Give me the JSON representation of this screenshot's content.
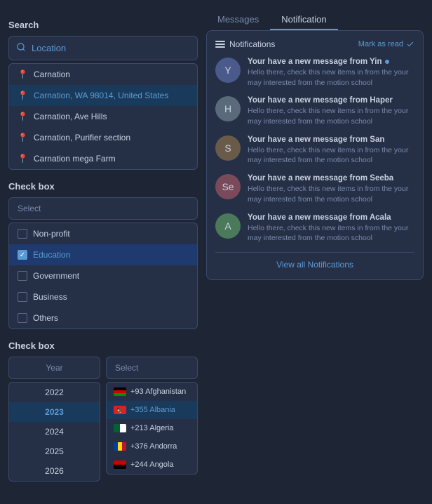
{
  "search": {
    "title": "Search",
    "placeholder": "Location",
    "results": [
      {
        "label": "Carnation",
        "selected": false
      },
      {
        "label": "Carnation, WA 98014, United States",
        "selected": true
      },
      {
        "label": "Carnation, Ave Hills",
        "selected": false
      },
      {
        "label": "Carnation, Purifier section",
        "selected": false
      },
      {
        "label": "Carnation mega Farm",
        "selected": false
      }
    ]
  },
  "checkbox1": {
    "title": "Check box",
    "placeholder": "Select",
    "items": [
      {
        "label": "Non-profit",
        "checked": false
      },
      {
        "label": "Education",
        "checked": true
      },
      {
        "label": "Government",
        "checked": false
      },
      {
        "label": "Business",
        "checked": false
      },
      {
        "label": "Others",
        "checked": false
      }
    ]
  },
  "checkbox2": {
    "title": "Check box",
    "year_placeholder": "Year",
    "country_placeholder": "Select",
    "years": [
      {
        "value": "2022",
        "selected": false
      },
      {
        "value": "2023",
        "selected": true
      },
      {
        "value": "2024",
        "selected": false
      },
      {
        "value": "2025",
        "selected": false
      },
      {
        "value": "2026",
        "selected": false
      }
    ],
    "countries": [
      {
        "code": "AF",
        "dial": "+93",
        "name": "Afghanistan",
        "selected": false,
        "color": "#000000"
      },
      {
        "code": "AL",
        "dial": "+355",
        "name": "Albania",
        "selected": true,
        "color": "#e41e20"
      },
      {
        "code": "DZ",
        "dial": "+213",
        "name": "Algeria",
        "selected": false,
        "color": "#006233"
      },
      {
        "code": "AD",
        "dial": "+376",
        "name": "Andorra",
        "selected": false,
        "color": "#003DA5"
      },
      {
        "code": "AO",
        "dial": "+244",
        "name": "Angola",
        "selected": false,
        "color": "#CC0000"
      }
    ]
  },
  "tabs": {
    "items": [
      {
        "label": "Messages",
        "active": false
      },
      {
        "label": "Notification",
        "active": true
      }
    ]
  },
  "notifications": {
    "header": "Notifications",
    "mark_read": "Mark as read",
    "view_all": "View all Notifications",
    "items": [
      {
        "title": "Your have a new message from Yin",
        "body": "Hello there, check this new items in from the your may interested from the motion school",
        "has_dot": true,
        "avatar_color": "#4a5a8a",
        "avatar_text": "Y"
      },
      {
        "title": "Your have a new message from Haper",
        "body": "Hello there, check this new items in from the your may interested from the motion school",
        "has_dot": false,
        "avatar_color": "#5a6a7a",
        "avatar_text": "H"
      },
      {
        "title": "Your have a new message from San",
        "body": "Hello there, check this new items in from the your may interested from the motion school",
        "has_dot": false,
        "avatar_color": "#6a5a4a",
        "avatar_text": "S"
      },
      {
        "title": "Your have a new message from Seeba",
        "body": "Hello there, check this new items in from the your may interested from the motion school",
        "has_dot": false,
        "avatar_color": "#7a4a5a",
        "avatar_text": "Se"
      },
      {
        "title": "Your have a new message from Acala",
        "body": "Hello there, check this new items in from the your may interested from the motion school",
        "has_dot": false,
        "avatar_color": "#4a7a5a",
        "avatar_text": "A"
      }
    ]
  }
}
